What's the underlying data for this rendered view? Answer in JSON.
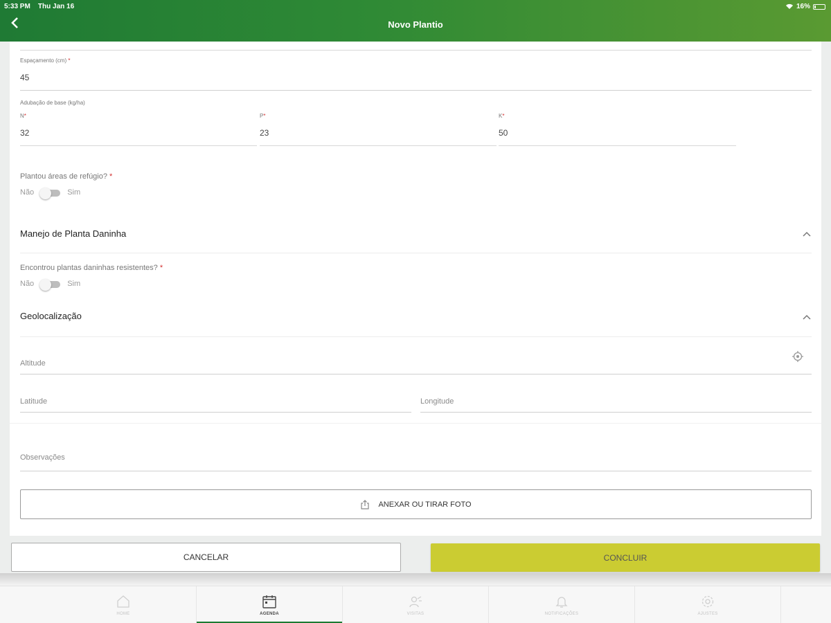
{
  "status_bar": {
    "time": "5:33 PM",
    "date": "Thu Jan 16",
    "battery": "16%"
  },
  "header": {
    "title": "Novo Plantio"
  },
  "form": {
    "spacing": {
      "label": "Espaçamento (cm)",
      "required_mark": "*",
      "value": "45"
    },
    "fertilization": {
      "label": "Adubação de base (kg/ha)",
      "n": {
        "label": "N",
        "required_mark": "*",
        "value": "32"
      },
      "p": {
        "label": "P",
        "required_mark": "*",
        "value": "23"
      },
      "k": {
        "label": "K",
        "required_mark": "*",
        "value": "50"
      }
    },
    "refuge": {
      "question": "Plantou áreas de refúgio?",
      "required_mark": "*",
      "off_label": "Não",
      "on_label": "Sim"
    },
    "weed_section": {
      "title": "Manejo de Planta Daninha"
    },
    "weed_resistant": {
      "question": "Encontrou plantas daninhas resistentes?",
      "required_mark": "*",
      "off_label": "Não",
      "on_label": "Sim"
    },
    "geo_section": {
      "title": "Geolocalização"
    },
    "altitude": {
      "placeholder": "Altitude"
    },
    "latitude": {
      "placeholder": "Latitude"
    },
    "longitude": {
      "placeholder": "Longitude"
    },
    "observations": {
      "placeholder": "Observações"
    },
    "attach_label": "ANEXAR OU TIRAR FOTO"
  },
  "actions": {
    "cancel_label": "CANCELAR",
    "done_label": "CONCLUIR",
    "done_color": "#cbcc32"
  },
  "tabbar": {
    "active_color": "#1b7a32",
    "tabs": [
      {
        "label": "HOME",
        "icon": "home-icon"
      },
      {
        "label": "AGENDA",
        "icon": "calendar-icon"
      },
      {
        "label": "VISITAS",
        "icon": "visits-icon"
      },
      {
        "label": "NOTIFICAÇÕES",
        "icon": "bell-icon"
      },
      {
        "label": "AJUSTES",
        "icon": "gear-icon"
      }
    ]
  }
}
